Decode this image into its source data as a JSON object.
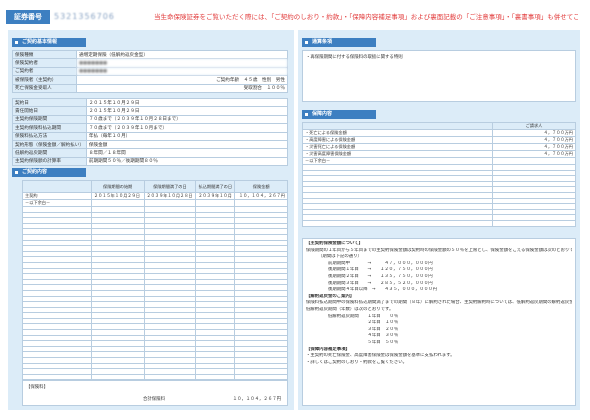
{
  "header": {
    "cert_label": "証券番号",
    "cert_number": "5321356706",
    "notice": "当生命保険証券をご覧いただく際には、「ご契約のしおり・約款」・「保障内容補足事項」および裏面記載の「ご注意事項」・「裏書事項」も併せてご参照ください。"
  },
  "left": {
    "basic_title": "ご契約基本情報",
    "basic_rows": [
      {
        "label": "保険種類",
        "value": "通増定期保険（低解約返戻金型）"
      },
      {
        "label": "保険契約者",
        "value": ""
      },
      {
        "label": "ご契約者",
        "value": ""
      },
      {
        "label": "被保険者（主契約）",
        "value": "ご契約年齢　４５歳　性別　男性"
      },
      {
        "label": "死亡保険金受取人",
        "value": "受取割合　１００％"
      }
    ],
    "date_rows": [
      {
        "label": "契約日",
        "value": "２０１５年１０月２９日"
      },
      {
        "label": "責任開始日",
        "value": "２０１５年１０月２９日"
      },
      {
        "label": "主契約保険期間",
        "value": "７０歳まで（２０３９年１０月２８日まで）"
      },
      {
        "label": "主契約保険料払込期間",
        "value": "７０歳まで（２０３９年１０月まで）"
      },
      {
        "label": "保険料払込方法",
        "value": "年払（毎年１０月）"
      },
      {
        "label": "契約形態（保険金額／解約払い）",
        "value": "保険金額"
      },
      {
        "label": "低解約返戻期間",
        "value": "８年間／１８年間"
      },
      {
        "label": "主契約保険額の計算率",
        "value": "前期期間５０％／後期期間８０％"
      }
    ],
    "contract_title": "ご契約内容",
    "contract_headers": [
      "",
      "保険期間の始期",
      "保険期間満了の日",
      "払込期間満了の日",
      "保険金額"
    ],
    "contract_rows": [
      [
        "主契約",
        "２０１５年１０月２９日",
        "２０３９年１０月２８日",
        "２０３９年１０月",
        "１０，１０４，２６７円"
      ],
      [
        "－以下余白－",
        "",
        "",
        "",
        ""
      ]
    ],
    "footer_label": "【保険料】",
    "footer_total_label": "合計保険料",
    "footer_total_value": "１０，１０４，２６７円"
  },
  "right": {
    "special_title": "通算条項",
    "special_text": "・再保険期間に付する保険料の取扱に関する特則",
    "coverage_title": "保障内容",
    "coverage_col": "ご請求人",
    "coverage_rows": [
      {
        "label": "・死亡による保険金額",
        "value": "４，７００万円"
      },
      {
        "label": "・高度障害による保険金額",
        "value": "４，７００万円"
      },
      {
        "label": "・災害死亡による保険金額",
        "value": "４，７００万円"
      },
      {
        "label": "・災害高度障害保険金額",
        "value": "４，７００万円"
      },
      {
        "label": "－以下余白－",
        "value": ""
      }
    ],
    "notes": [
      {
        "text": "【主契約保険金額について】",
        "cls": "bold"
      },
      {
        "text": "保険期間の１年目から５年目までの主契約保険金額は契約時の保険金額の５０％を上限とし、保険金額をこえる保険金額は次のとおりです。",
        "cls": ""
      },
      {
        "text": "（期間は下記の通り）",
        "cls": "indent"
      },
      {
        "text": "前期期間中　　　　→　　　４７，０００，０００円",
        "cls": "indent2"
      },
      {
        "text": "後期期間１年目　　→　　１２０，７５０，０００円",
        "cls": "indent2"
      },
      {
        "text": "後期期間２年目　　→　　１３５，７５０，０００円",
        "cls": "indent2"
      },
      {
        "text": "後期期間３年目　　→　　２８５，５２０，０００円",
        "cls": "indent2"
      },
      {
        "text": "後期期間４年目以降　→　　４３５，０００，０００円",
        "cls": "indent2"
      },
      {
        "text": "【解約返戻金のご案内】",
        "cls": "bold"
      },
      {
        "text": "保険料払込期間中の保険料払込期間満了までの期間（８年）に解約された場合、主契約解約時については、低解約返戻期間の解約返戻金は通常の解約返戻金の割合とします。",
        "cls": ""
      },
      {
        "text": "低解約返戻期間（年数）は次のとおりです。",
        "cls": ""
      },
      {
        "text": "低解約返戻期間　　１年目　　０％",
        "cls": "indent2"
      },
      {
        "text": "　　　　　　　　　２年目　１０％",
        "cls": "indent2"
      },
      {
        "text": "　　　　　　　　　３年目　２０％",
        "cls": "indent2"
      },
      {
        "text": "　　　　　　　　　４年目　３０％",
        "cls": "indent2"
      },
      {
        "text": "　　　　　　　　　５年目　５０％",
        "cls": "indent2"
      },
      {
        "text": "【保障内容補足事項】",
        "cls": "bold"
      },
      {
        "text": "・主契約の死亡保険金、高度障害保険金は保険金額を基準に支払われます。",
        "cls": ""
      },
      {
        "text": "・詳しくはご契約のしおり・約款をご覧ください。",
        "cls": ""
      }
    ]
  }
}
